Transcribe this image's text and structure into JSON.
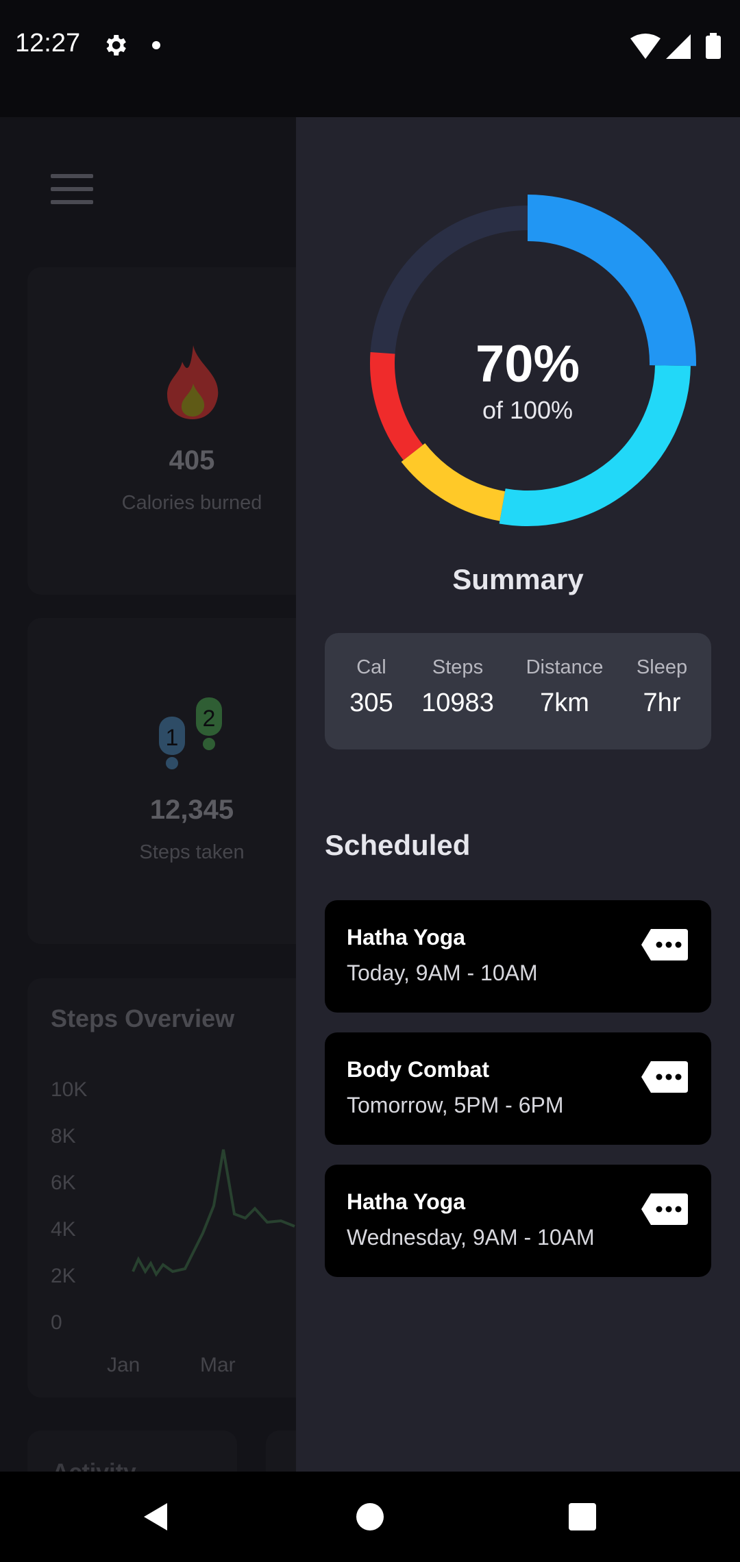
{
  "status_bar": {
    "time": "12:27",
    "icons": [
      "gear-icon",
      "dot-icon",
      "wifi-icon",
      "signal-icon",
      "battery-icon"
    ]
  },
  "dashboard": {
    "calories": {
      "value": "405",
      "label": "Calories burned",
      "icon": "flame-icon"
    },
    "steps": {
      "value": "12,345",
      "label": "Steps taken",
      "icon": "footsteps-icon"
    },
    "steps_overview": {
      "title": "Steps Overview",
      "y_ticks": [
        "10K",
        "8K",
        "6K",
        "4K",
        "2K",
        "0"
      ],
      "x_ticks": [
        "Jan",
        "Mar"
      ]
    },
    "activity_label": "Activity"
  },
  "drawer": {
    "progress": {
      "percent_label": "70%",
      "subtitle": "of 100%",
      "value": 70
    },
    "summary_title": "Summary",
    "stats": [
      {
        "label": "Cal",
        "value": "305"
      },
      {
        "label": "Steps",
        "value": "10983"
      },
      {
        "label": "Distance",
        "value": "7km"
      },
      {
        "label": "Sleep",
        "value": "7hr"
      }
    ],
    "scheduled_title": "Scheduled",
    "scheduled": [
      {
        "name": "Hatha Yoga",
        "time": "Today, 9AM - 10AM"
      },
      {
        "name": "Body Combat",
        "time": "Tomorrow, 5PM - 6PM"
      },
      {
        "name": "Hatha Yoga",
        "time": "Wednesday, 9AM - 10AM"
      }
    ]
  },
  "colors": {
    "drawer_bg": "#23232d",
    "ring_blue": "#2196f3",
    "ring_cyan": "#22d8f8",
    "ring_yellow": "#ffc928",
    "ring_red": "#ef2b2b",
    "ring_track": "#2a2f45"
  }
}
